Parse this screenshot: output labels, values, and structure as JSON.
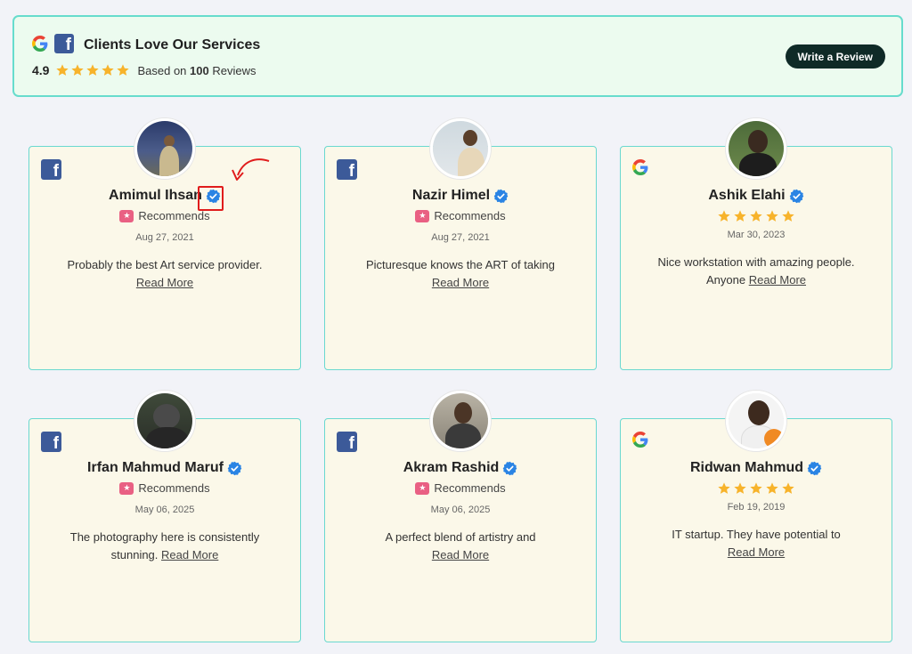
{
  "header": {
    "title": "Clients Love Our Services",
    "rating": "4.9",
    "based_prefix": "Based on",
    "review_count": "100",
    "based_suffix": "Reviews",
    "write_review_label": "Write a Review"
  },
  "colors": {
    "accent_border": "#67dccd",
    "star": "#f7b32b",
    "verified": "#2a84e4",
    "recommend": "#e96083",
    "facebook": "#3c5a99",
    "button": "#0f2a27"
  },
  "reviews": [
    {
      "source": "facebook",
      "name": "Amimul Ihsan",
      "badge": "Recommends",
      "date": "Aug 27, 2021",
      "text": "Probably the best Art service provider.",
      "read_more": "Read More"
    },
    {
      "source": "facebook",
      "name": "Nazir Himel",
      "badge": "Recommends",
      "date": "Aug 27, 2021",
      "text": "Picturesque knows the ART of taking",
      "read_more": "Read More"
    },
    {
      "source": "google",
      "name": "Ashik Elahi",
      "stars": 5,
      "date": "Mar 30, 2023",
      "text": "Nice workstation with amazing people. Anyone",
      "read_more": "Read More"
    },
    {
      "source": "facebook",
      "name": "Irfan Mahmud Maruf",
      "badge": "Recommends",
      "date": "May 06, 2025",
      "text": "The photography here is consistently stunning.",
      "read_more": "Read More"
    },
    {
      "source": "facebook",
      "name": "Akram Rashid",
      "badge": "Recommends",
      "date": "May 06, 2025",
      "text": "A perfect blend of artistry and",
      "read_more": "Read More"
    },
    {
      "source": "google",
      "name": "Ridwan Mahmud",
      "stars": 5,
      "date": "Feb 19, 2019",
      "text": "IT startup. They have potential to",
      "read_more": "Read More"
    }
  ]
}
